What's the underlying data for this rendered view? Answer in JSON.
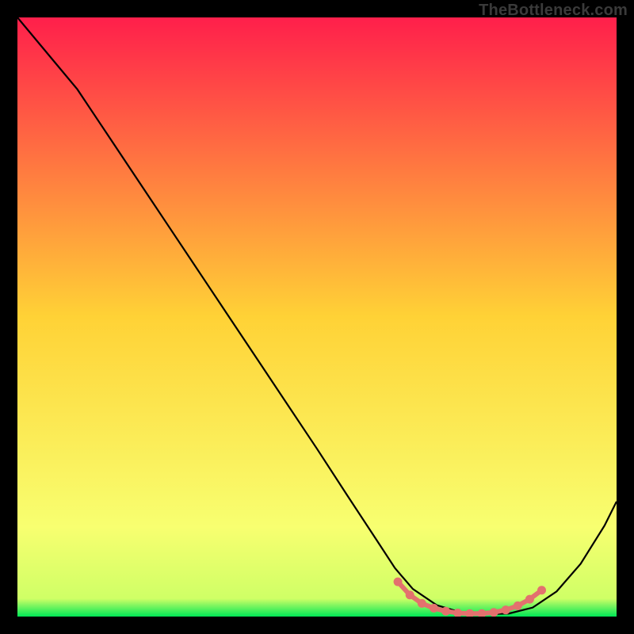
{
  "watermark": "TheBottleneck.com",
  "colors": {
    "top": "#ff1f4b",
    "mid": "#ffd236",
    "low": "#f8ff70",
    "green": "#00e756",
    "curve": "#000000",
    "marker": "#e3716e",
    "bg": "#000000"
  },
  "chart_data": {
    "type": "line",
    "title": "",
    "xlabel": "",
    "ylabel": "",
    "xlim": [
      0,
      100
    ],
    "ylim": [
      0,
      100
    ],
    "note": "Axes are unlabeled in the source; values below are read as percentage of plot area (0 = left/bottom, 100 = right/top).",
    "series": [
      {
        "name": "curve",
        "color": "#000000",
        "x": [
          0,
          5,
          10,
          15,
          20,
          25,
          30,
          35,
          40,
          45,
          50,
          55,
          60,
          63,
          66,
          70,
          74,
          78,
          82,
          86,
          90,
          94,
          98,
          100
        ],
        "y": [
          100,
          94,
          88,
          80.5,
          73,
          65.5,
          58,
          50.5,
          43,
          35.5,
          28,
          20.3,
          12.7,
          8.1,
          4.6,
          1.9,
          0.7,
          0.4,
          0.5,
          1.5,
          4.2,
          8.8,
          15.2,
          19.2
        ]
      },
      {
        "name": "optimal-band",
        "color": "#e3716e",
        "marker": "circle",
        "x": [
          63.5,
          65.5,
          67.5,
          69.5,
          71.5,
          73.5,
          75.5,
          77.5,
          79.5,
          81.5,
          83.5,
          85.5,
          87.5
        ],
        "y": [
          5.8,
          3.6,
          2.2,
          1.4,
          0.9,
          0.6,
          0.5,
          0.5,
          0.7,
          1.1,
          1.8,
          2.9,
          4.4
        ]
      }
    ],
    "gradient_stops": [
      {
        "pct": 0,
        "color": "#ff1f4b"
      },
      {
        "pct": 50,
        "color": "#ffd236"
      },
      {
        "pct": 85,
        "color": "#f8ff70"
      },
      {
        "pct": 97,
        "color": "#cfff66"
      },
      {
        "pct": 100,
        "color": "#00e756"
      }
    ]
  }
}
